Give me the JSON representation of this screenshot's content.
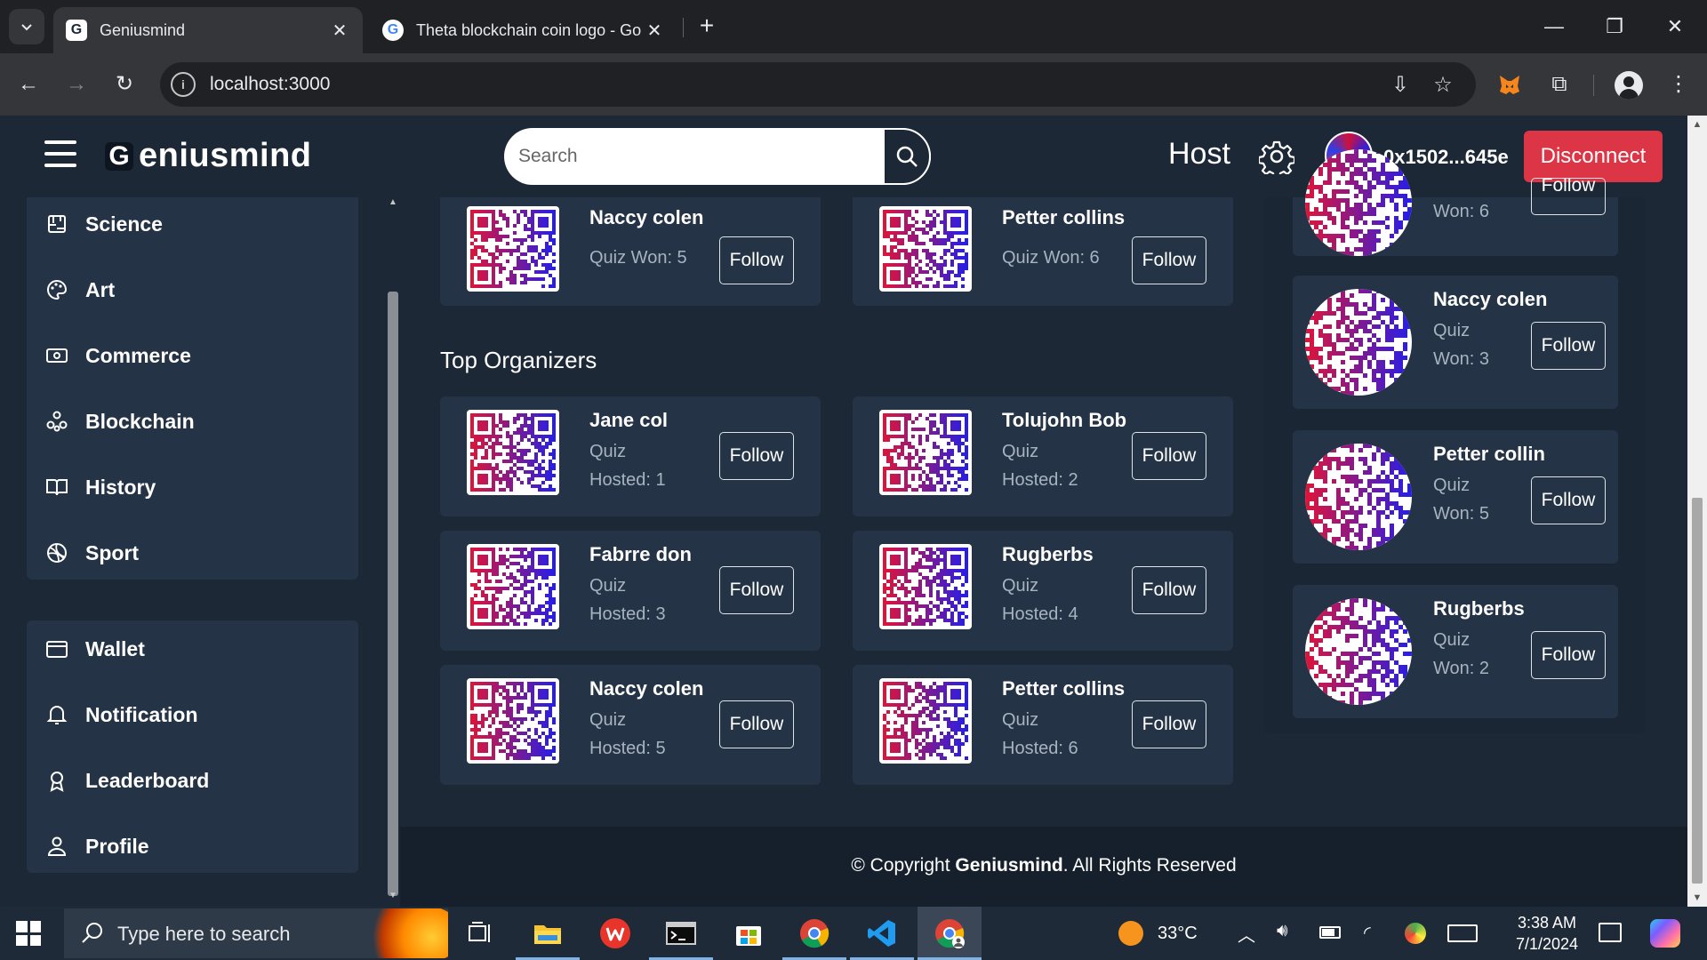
{
  "browser": {
    "tabs": [
      {
        "title": "Geniusmind",
        "favicon": "G",
        "active": true
      },
      {
        "title": "Theta blockchain coin logo - Go",
        "favicon": "G",
        "active": false
      }
    ],
    "url": "localhost:3000"
  },
  "header": {
    "brand_name": "eniusmind",
    "brand_logo_letter": "G",
    "search_placeholder": "Search",
    "host_label": "Host",
    "wallet_address": "0x1502...645e",
    "disconnect_label": "Disconnect"
  },
  "sidebar": {
    "categories": [
      {
        "label": "Science",
        "icon": "science-icon"
      },
      {
        "label": "Art",
        "icon": "palette-icon"
      },
      {
        "label": "Commerce",
        "icon": "money-icon"
      },
      {
        "label": "Blockchain",
        "icon": "blockchain-icon"
      },
      {
        "label": "History",
        "icon": "book-icon"
      },
      {
        "label": "Sport",
        "icon": "ball-icon"
      }
    ],
    "account": [
      {
        "label": "Wallet",
        "icon": "wallet-icon"
      },
      {
        "label": "Notification",
        "icon": "bell-icon"
      },
      {
        "label": "Leaderboard",
        "icon": "award-icon"
      },
      {
        "label": "Profile",
        "icon": "person-icon"
      }
    ]
  },
  "main": {
    "top_winners_partial": [
      {
        "name": "Naccy colen",
        "stat": "Quiz Won: 5",
        "follow": "Follow"
      },
      {
        "name": "Petter collins",
        "stat": "Quiz Won: 6",
        "follow": "Follow"
      }
    ],
    "organizers_title": "Top Organizers",
    "organizers": [
      {
        "name": "Jane col",
        "stat_line1": "Quiz",
        "stat_line2": "Hosted: 1",
        "follow": "Follow"
      },
      {
        "name": "Tolujohn Bob",
        "stat_line1": "Quiz",
        "stat_line2": "Hosted: 2",
        "follow": "Follow"
      },
      {
        "name": "Fabrre don",
        "stat_line1": "Quiz",
        "stat_line2": "Hosted: 3",
        "follow": "Follow"
      },
      {
        "name": "Rugberbs",
        "stat_line1": "Quiz",
        "stat_line2": "Hosted: 4",
        "follow": "Follow"
      },
      {
        "name": "Naccy colen",
        "stat_line1": "Quiz",
        "stat_line2": "Hosted: 5",
        "follow": "Follow"
      },
      {
        "name": "Petter collins",
        "stat_line1": "Quiz",
        "stat_line2": "Hosted: 6",
        "follow": "Follow"
      }
    ]
  },
  "right_panel": {
    "partial": {
      "stat": "Won: 6",
      "follow": "Follow"
    },
    "cards": [
      {
        "name": "Naccy colen",
        "stat_line1": "Quiz",
        "stat_line2": "Won: 3",
        "follow": "Follow"
      },
      {
        "name": "Petter collin",
        "stat_line1": "Quiz",
        "stat_line2": "Won: 5",
        "follow": "Follow"
      },
      {
        "name": "Rugberbs",
        "stat_line1": "Quiz",
        "stat_line2": "Won: 2",
        "follow": "Follow"
      }
    ]
  },
  "footer": {
    "prefix": "© Copyright ",
    "brand": "Geniusmind",
    "suffix": ". All Rights Reserved"
  },
  "taskbar": {
    "search_placeholder": "Type here to search",
    "temperature": "33°C",
    "time": "3:38 AM",
    "date": "7/1/2024"
  },
  "colors": {
    "page_bg": "#1c2836",
    "card_bg": "#243345",
    "disconnect": "#dc3545",
    "muted_text": "#a8b3c0"
  }
}
